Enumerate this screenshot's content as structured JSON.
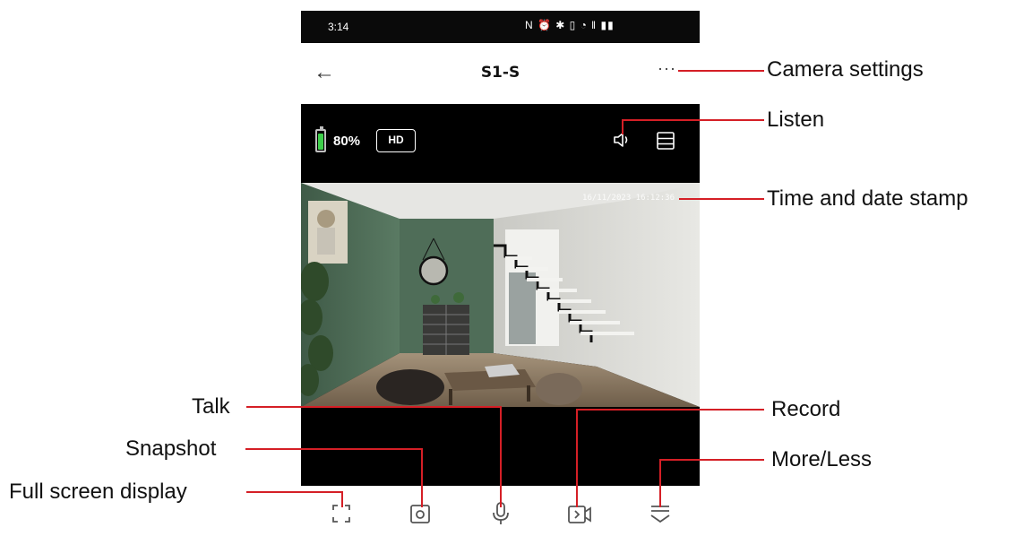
{
  "status_bar": {
    "time": "3:14",
    "icons": "N ⏰ ✱ ▯ ◔ ‖ ▮▮"
  },
  "nav": {
    "back_icon": "arrow-left",
    "title": "S1-S",
    "more_icon": "ellipsis"
  },
  "viewer": {
    "battery_level": 0.8,
    "battery_text": "80%",
    "quality_badge": "HD",
    "timestamp": "16/11/2023 16:12:36",
    "battery_color": "#3ecf4b"
  },
  "controls": [
    {
      "name": "full-screen",
      "icon": "fullscreen-icon"
    },
    {
      "name": "snapshot",
      "icon": "camera-icon"
    },
    {
      "name": "talk",
      "icon": "microphone-icon"
    },
    {
      "name": "record",
      "icon": "video-record-icon"
    },
    {
      "name": "more-less",
      "icon": "chevron-lines-icon"
    }
  ],
  "annotations": {
    "camera_settings": "Camera settings",
    "listen": "Listen",
    "time_date_stamp": "Time and date stamp",
    "talk": "Talk",
    "record": "Record",
    "snapshot": "Snapshot",
    "more_less": "More/Less",
    "full_screen": "Full screen display"
  },
  "colors": {
    "annotation_line": "#d51f26",
    "status_bar_bg": "#0a0a0a",
    "viewer_bg": "#000000"
  }
}
